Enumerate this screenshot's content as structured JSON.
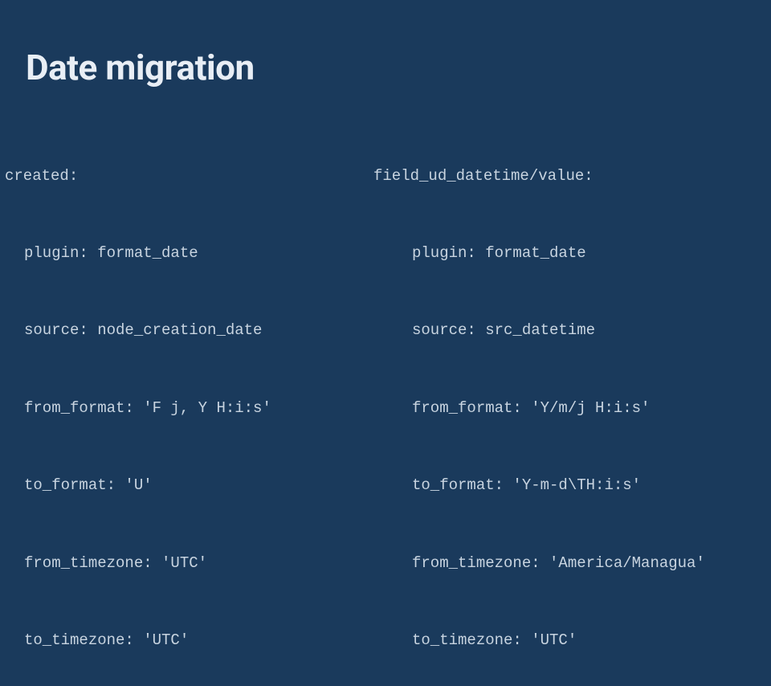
{
  "title": "Date migration",
  "left": {
    "header": "created:",
    "lines": [
      "plugin: format_date",
      "source: node_creation_date",
      "from_format: 'F j, Y H:i:s'",
      "to_format: 'U'",
      "from_timezone: 'UTC'",
      "to_timezone: 'UTC'"
    ]
  },
  "right": {
    "header": "field_ud_datetime/value:",
    "lines": [
      "plugin: format_date",
      "source: src_datetime",
      "from_format: 'Y/m/j H:i:s'",
      "to_format: 'Y-m-d\\TH:i:s'",
      "from_timezone: 'America/Managua'",
      "to_timezone: 'UTC'"
    ]
  }
}
